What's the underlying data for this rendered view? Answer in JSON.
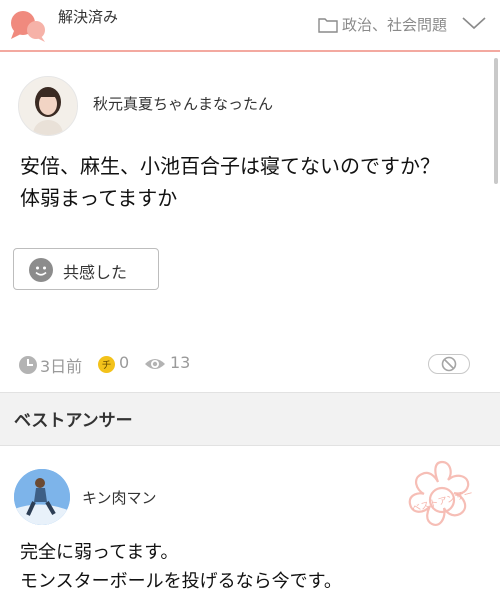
{
  "header": {
    "status": "解決済み",
    "category": "政治、社会問題"
  },
  "question": {
    "author": "秋元真夏ちゃんまなったん",
    "lines": [
      "安倍、麻生、小池百合子は寝てないのですか？",
      "体弱まってますか"
    ],
    "empathy_label": "共感した",
    "posted": "3日前",
    "coins": "0",
    "views": "13"
  },
  "best_answer": {
    "section_title": "ベストアンサー",
    "author": "キン肉マン",
    "stamp_text": "ベストアンサー",
    "lines": [
      "完全に弱ってます。",
      "モンスターボールを投げるなら今です。"
    ]
  },
  "colors": {
    "accent": "#f3a9a0",
    "status_icon": "#f08a7e",
    "coin": "#f3c21a"
  }
}
